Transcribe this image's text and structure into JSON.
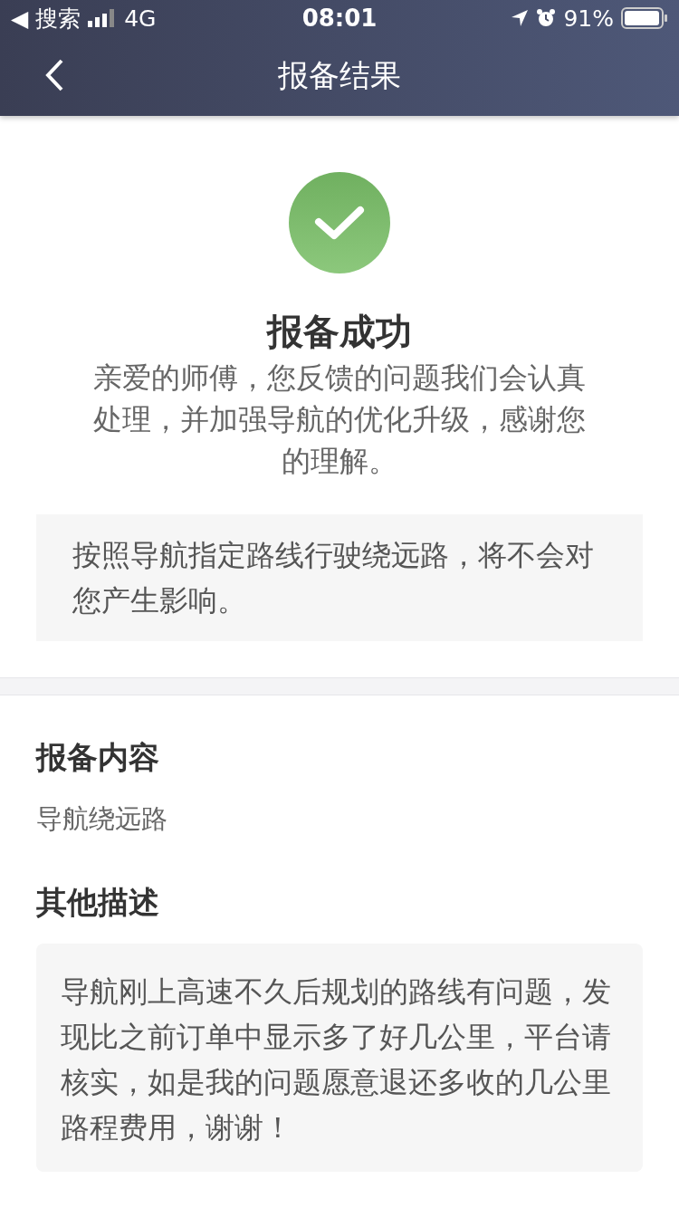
{
  "status_bar": {
    "back_app": "◀ 搜索",
    "network": "4G",
    "time": "08:01",
    "battery": "91%"
  },
  "nav_bar": {
    "title": "报备结果"
  },
  "result": {
    "title": "报备成功",
    "message": "亲爱的师傅，您反馈的问题我们会认真处理，并加强导航的优化升级，感谢您的理解。",
    "note": "按照导航指定路线行驶绕远路，将不会对您产生影响。"
  },
  "sections": [
    {
      "heading": "报备内容",
      "kind": "text",
      "content": "导航绕远路"
    },
    {
      "heading": "其他描述",
      "kind": "box",
      "content": "导航刚上高速不久后规划的路线有问题，发现比之前订单中显示多了好几公里，平台请核实，如是我的问题愿意退还多收的几公里路程费用，谢谢！"
    }
  ]
}
